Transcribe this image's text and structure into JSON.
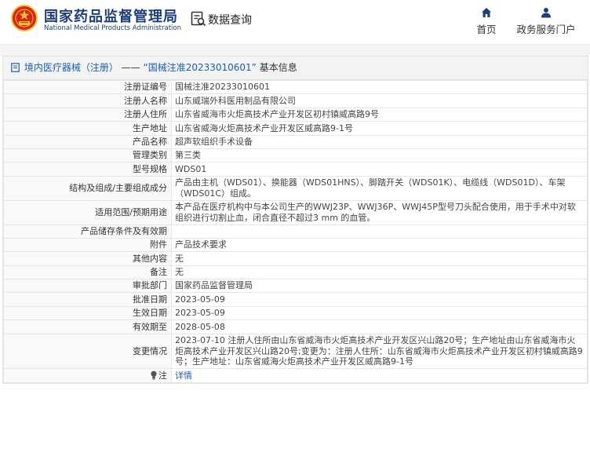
{
  "header": {
    "site_name": "国家药品监督管理局",
    "site_name_en": "National Medical Products Administration",
    "query_label": "数据查询",
    "nav": {
      "home": "首页",
      "gov": "政务服务门户"
    }
  },
  "breadcrumb": {
    "category": "境内医疗器械（注册）",
    "separator": " —— ",
    "title": "“国械注准20233010601”",
    "suffix": " 基本信息"
  },
  "rows": [
    {
      "label": "注册证编号",
      "value": "国械注准20233010601"
    },
    {
      "label": "注册人名称",
      "value": "山东威瑞外科医用制品有限公司"
    },
    {
      "label": "注册人住所",
      "value": "山东省威海市火炬高技术产业开发区初村镇威高路9号"
    },
    {
      "label": "生产地址",
      "value": "山东省威海火炬高技术产业开发区威高路9-1号"
    },
    {
      "label": "产品名称",
      "value": "超声软组织手术设备"
    },
    {
      "label": "管理类别",
      "value": "第三类"
    },
    {
      "label": "型号规格",
      "value": "WDS01"
    },
    {
      "label": "结构及组成/主要组成成分",
      "value": "产品由主机（WDS01）、换能器（WDS01HNS）、脚踏开关（WDS01K）、电缆线（WDS01D）、车架（WDS01C）组成。"
    },
    {
      "label": "适用范围/预期用途",
      "value": "本产品在医疗机构中与本公司生产的WWJ23P、WWJ36P、WWJ45P型号刀头配合使用，用于手术中对软组织进行切割止血，闭合直径不超过3 mm 的血管。"
    },
    {
      "label": "产品储存条件及有效期",
      "value": ""
    },
    {
      "label": "附件",
      "value": "产品技术要求"
    },
    {
      "label": "其他内容",
      "value": "无"
    },
    {
      "label": "备注",
      "value": "无"
    },
    {
      "label": "审批部门",
      "value": "国家药品监督管理局"
    },
    {
      "label": "批准日期",
      "value": "2023-05-09"
    },
    {
      "label": "生效日期",
      "value": "2023-05-09"
    },
    {
      "label": "有效期至",
      "value": "2028-05-08"
    },
    {
      "label": "变更情况",
      "value": "2023-07-10 注册人住所由山东省威海市火炬高技术产业开发区兴山路20号；生产地址由山东省威海市火炬高技术产业开发区兴山路20号;变更为：注册人住所：山东省威海市火炬高技术产业开发区初村镇威高路9号；生产地址：山东省威海火炬高技术产业开发区威高路9-1号"
    }
  ],
  "note_row": {
    "label": "注",
    "link": "详情"
  },
  "colors": {
    "brand": "#1c3f7a",
    "link": "#1a5fb4",
    "emblem_red": "#d7261e",
    "emblem_gold": "#f4c430"
  },
  "icons": [
    "national-emblem-icon",
    "data-query-icon",
    "home-icon",
    "user-icon",
    "document-icon",
    "lightbulb-icon"
  ]
}
